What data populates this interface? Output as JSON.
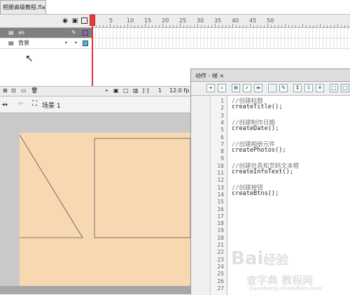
{
  "document_tab": {
    "title": "相册高级教程.fla*"
  },
  "timeline": {
    "header_icons": [
      "eye-icon",
      "lock-icon",
      "outline-icon"
    ],
    "frame_numbers": [
      "5",
      "10",
      "15",
      "20",
      "25",
      "30",
      "35",
      "40",
      "45",
      "50"
    ],
    "layers": [
      {
        "name": "as",
        "color": "#9b59d0",
        "selected": true
      },
      {
        "name": "背景",
        "color": "#39c3e0",
        "selected": false
      }
    ],
    "footer": {
      "frame": "1",
      "fps": "12.0 fp"
    }
  },
  "scene": {
    "label": "场景 1"
  },
  "actions_panel": {
    "title": "动作 - 帧 ×",
    "line_numbers": [
      "1",
      "2",
      "3",
      "4",
      "5",
      "6",
      "7",
      "8",
      "9",
      "10",
      "11",
      "12",
      "13",
      "14",
      "15",
      "16",
      "17",
      "18",
      "19",
      "20",
      "21",
      "22",
      "23",
      "24",
      "25",
      "26",
      "27"
    ],
    "code": [
      {
        "line": 1,
        "text": "//创建标题",
        "comment": true
      },
      {
        "line": 2,
        "text": "createTitle();",
        "comment": false
      },
      {
        "line": 4,
        "text": "//创建制作日期",
        "comment": true
      },
      {
        "line": 5,
        "text": "createDate();",
        "comment": false
      },
      {
        "line": 7,
        "text": "//创建相册元件",
        "comment": true
      },
      {
        "line": 8,
        "text": "createPhotos();",
        "comment": false
      },
      {
        "line": 10,
        "text": "//创建信息和页码文本框",
        "comment": true
      },
      {
        "line": 11,
        "text": "createInfoText();",
        "comment": false
      },
      {
        "line": 13,
        "text": "//创建按钮",
        "comment": true
      },
      {
        "line": 14,
        "text": "createBtns();",
        "comment": false
      }
    ]
  },
  "watermark": {
    "text1": "Bai",
    "text2": "经验",
    "text3": "查字典 教程网",
    "text4": "jiaocheng.chazidian.com"
  },
  "colors": {
    "stage": "#f8d8b0",
    "playhead": "#dd3333"
  }
}
